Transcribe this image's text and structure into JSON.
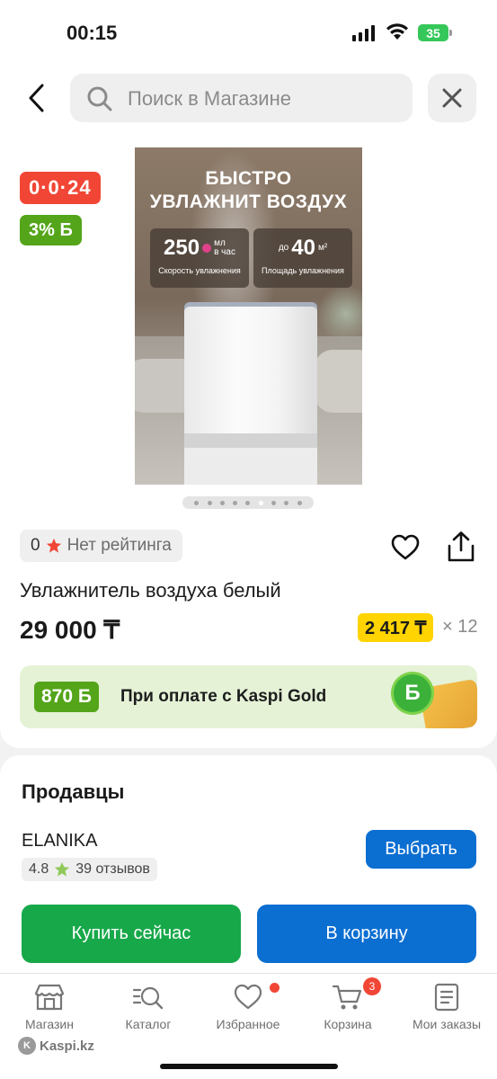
{
  "status_bar": {
    "time": "00:15",
    "battery": "35"
  },
  "search": {
    "placeholder": "Поиск в Магазине"
  },
  "badges": {
    "timer": "0·0·24",
    "bonus": "3% Б"
  },
  "product_image": {
    "headline_1": "БЫСТРО",
    "headline_2": "УВЛАЖНИТ ВОЗДУХ",
    "stat1_value": "250",
    "stat1_unit_1": "мл",
    "stat1_unit_2": "в час",
    "stat1_label": "Скорость увлажнения",
    "stat2_prefix": "до",
    "stat2_value": "40",
    "stat2_unit": "м²",
    "stat2_label": "Площадь увлажнения"
  },
  "carousel": {
    "count": 9,
    "active_index": 5
  },
  "rating": {
    "value": "0",
    "text": "Нет рейтинга"
  },
  "product": {
    "title": "Увлажнитель воздуха белый",
    "price": "29 000 ₸",
    "installment": "2 417 ₸",
    "installment_months": "× 12"
  },
  "promo": {
    "bonus": "870 Б",
    "text": "При оплате с Kaspi Gold",
    "coin": "Б"
  },
  "sellers": {
    "title": "Продавцы",
    "seller_name": "ELANIKA",
    "seller_rating": "4.8",
    "seller_reviews": "39 отзывов",
    "choose_label": "Выбрать"
  },
  "actions": {
    "buy_now": "Купить сейчас",
    "add_to_cart": "В корзину"
  },
  "tabbar": {
    "store": "Магазин",
    "catalog": "Каталог",
    "favorites": "Избранное",
    "cart": "Корзина",
    "cart_count": "3",
    "orders": "Мои заказы"
  },
  "watermark": "Kaspi.kz",
  "colors": {
    "accent_blue": "#0b6ed1",
    "buy_green": "#17a84a",
    "bonus_green": "#54a51a",
    "red": "#f14635",
    "installment_yellow": "#ffd400"
  }
}
